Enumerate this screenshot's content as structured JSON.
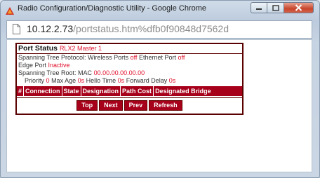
{
  "window": {
    "title": "Radio Configuration/Diagnostic Utility - Google Chrome"
  },
  "address_bar": {
    "host": "10.12.2.73",
    "path": "/portstatus.htm%dfb0f90848d7562d"
  },
  "port_status": {
    "heading": "Port Status",
    "device": "RLX2 Master 1",
    "stp_label": "Spanning Tree Protocol: Wireless Ports",
    "stp_wireless_value": "off",
    "stp_ethernet_label": "Ethernet Port",
    "stp_ethernet_value": "off",
    "edge_label": "Edge Port",
    "edge_value": "Inactive",
    "root_label": "Spanning Tree Root: MAC",
    "root_mac": "00.00.00.00.00.00",
    "priority_label": "Priority",
    "priority_value": "0",
    "max_age_label": "Max Age",
    "max_age_value": "0s",
    "hello_label": "Hello Time",
    "hello_value": "0s",
    "fwd_label": "Forward Delay",
    "fwd_value": "0s",
    "columns": [
      "#",
      "Connection",
      "State",
      "Designation",
      "Path Cost",
      "Designated Bridge"
    ],
    "nav_buttons": [
      "Top",
      "Next",
      "Prev",
      "Refresh"
    ]
  },
  "colors": {
    "accent": "#a6001a",
    "value_red": "#e0102a"
  }
}
